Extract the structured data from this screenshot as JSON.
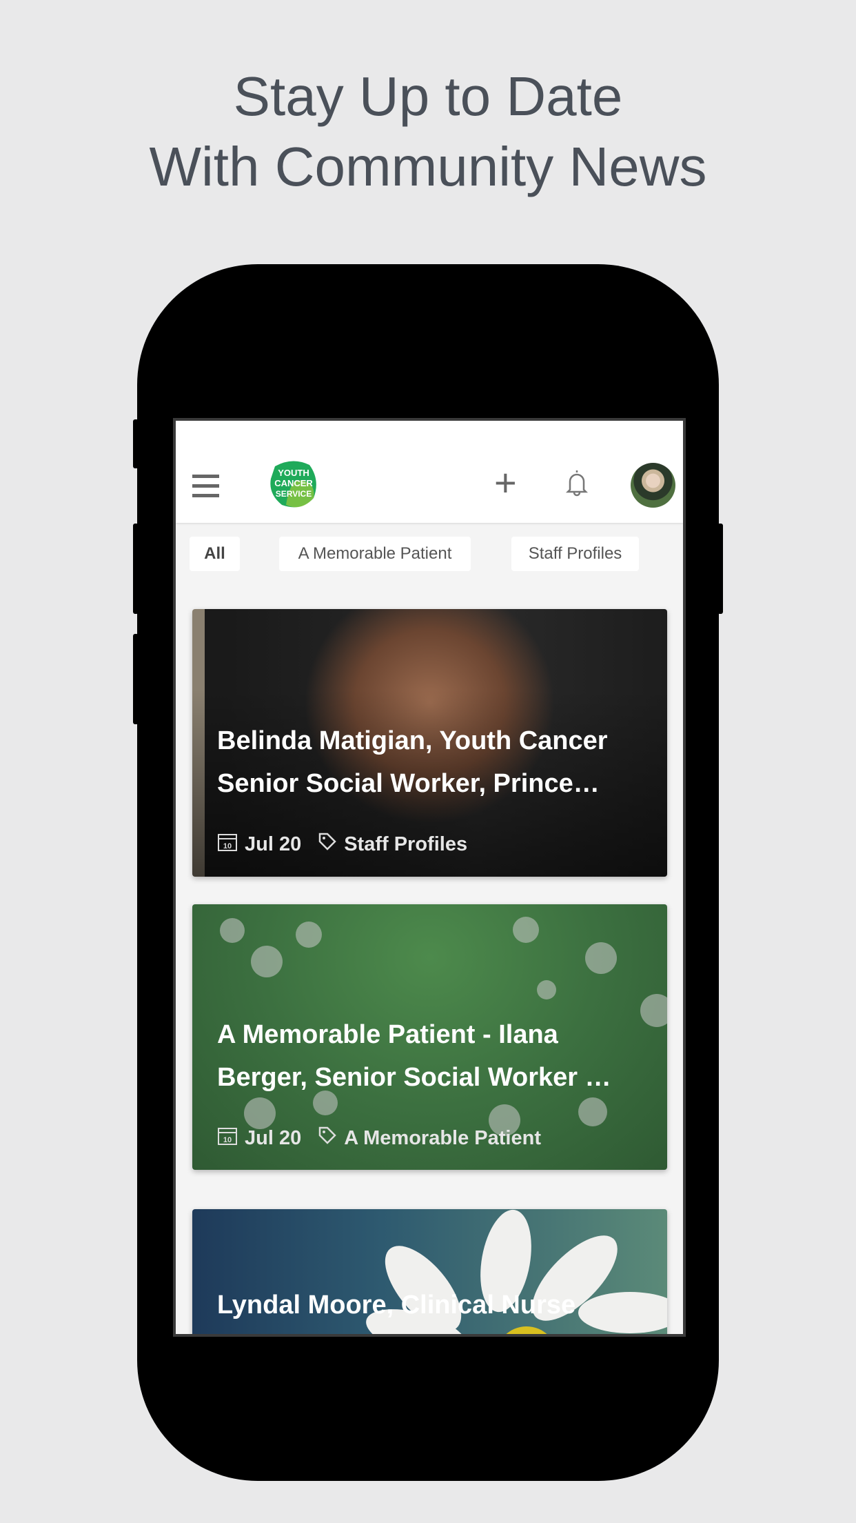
{
  "headline": {
    "line1": "Stay Up to Date",
    "line2": "With Community News"
  },
  "header": {
    "logo_text": "YOUTH CANCER SERVICE",
    "icons": [
      "menu-icon",
      "plus-icon",
      "bell-icon",
      "avatar"
    ]
  },
  "filters": [
    {
      "label": "All",
      "active": true
    },
    {
      "label": "A Memorable Patient",
      "active": false
    },
    {
      "label": "Staff Profiles",
      "active": false
    }
  ],
  "cards": [
    {
      "title": "Belinda Matigian, Youth Cancer Senior Social Worker, Prince…",
      "date": "Jul 20",
      "category": "Staff Profiles"
    },
    {
      "title": "A Memorable Patient - Ilana Berger, Senior Social Worker …",
      "date": "Jul 20",
      "category": "A Memorable Patient"
    },
    {
      "title": "Lyndal Moore, Clinical Nurse"
    }
  ],
  "colors": {
    "headline": "#4a5059",
    "brand_green": "#2fa84f"
  }
}
